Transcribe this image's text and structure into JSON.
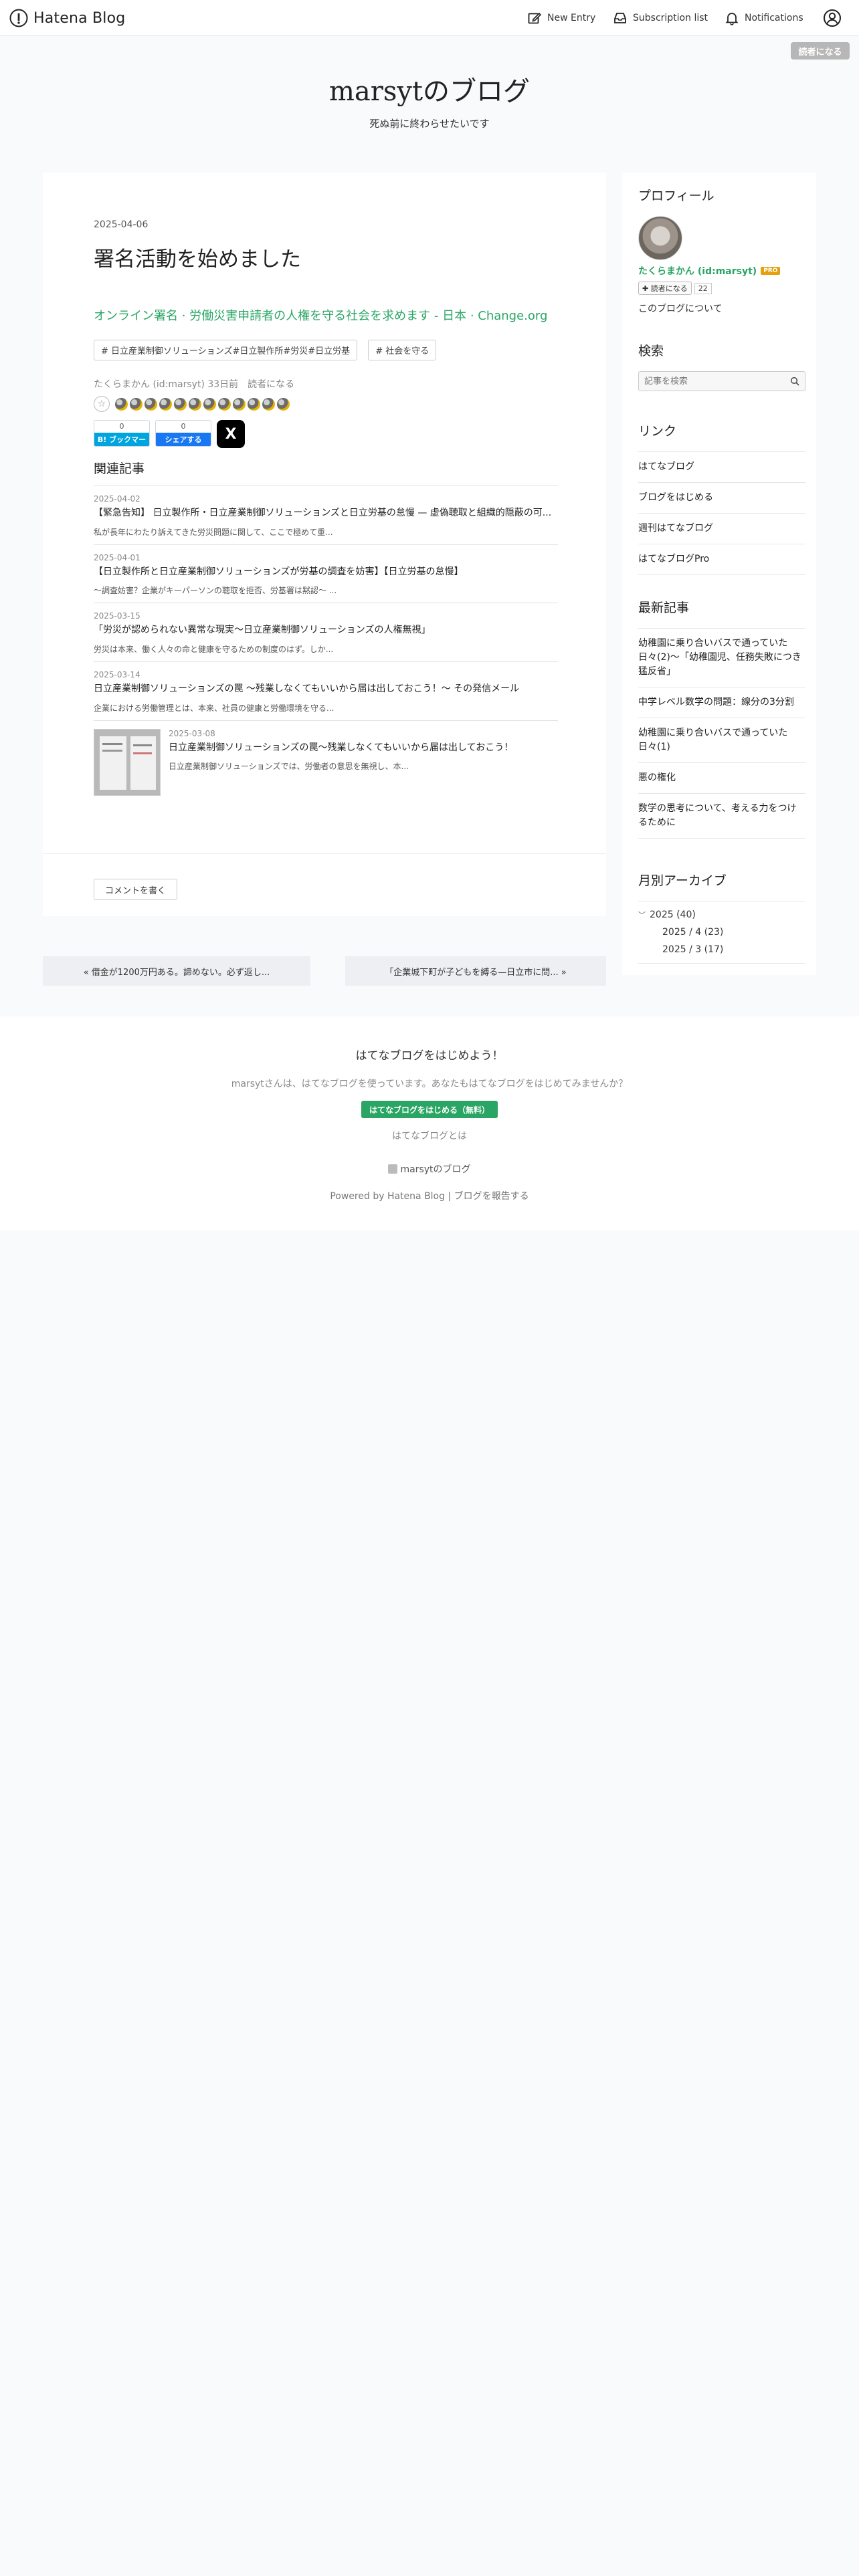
{
  "header": {
    "logo_text": "Hatena Blog",
    "new_entry": "New Entry",
    "subscription_list": "Subscription list",
    "notifications": "Notifications"
  },
  "reader_badge": "読者になる",
  "blog": {
    "title": "marsytのブログ",
    "description": "死ぬ前に終わらせたいです"
  },
  "article": {
    "date": "2025-04-06",
    "title": "署名活動を始めました",
    "link_text": "オンライン署名 · 労働災害申請者の人権を守る社会を求めます - 日本 · Change.org",
    "tags": [
      "# 日立産業制御ソリューションズ#日立製作所#労災#日立労基",
      "# 社会を守る"
    ],
    "byline": "たくらまかん (id:marsyt) 33日前　読者になる",
    "star_count": 12,
    "share": {
      "hatena_count": "0",
      "hatena_label": "B! ブックマーク",
      "fb_count": "0",
      "fb_label": "シェアする",
      "x_label": "X"
    },
    "related_heading": "関連記事",
    "related": [
      {
        "date": "2025-04-02",
        "title": "【緊急告知】 日立製作所・日立産業制御ソリューションズと日立労基の怠慢 — 虚偽聴取と組織的隠蔽の可...",
        "excerpt": "私が長年にわたり訴えてきた労災問題に関して、ここで極めて重..."
      },
      {
        "date": "2025-04-01",
        "title": "【日立製作所と日立産業制御ソリューションズが労基の調査を妨害】【日立労基の怠慢】",
        "excerpt": "〜調査妨害？企業がキーパーソンの聴取を拒否、労基署は黙認〜 ..."
      },
      {
        "date": "2025-03-15",
        "title": "「労災が認められない異常な現実〜日立産業制御ソリューションズの人権無視」",
        "excerpt": "労災は本来、働く人々の命と健康を守るための制度のはず。しか..."
      },
      {
        "date": "2025-03-14",
        "title": "日立産業制御ソリューションズの罠 〜残業しなくてもいいから届は出しておこう！〜 その発信メール",
        "excerpt": "企業における労働管理とは、本来、社員の健康と労働環境を守る..."
      },
      {
        "date": "2025-03-08",
        "title": "日立産業制御ソリューションズの罠〜残業しなくてもいいから届は出しておこう！",
        "excerpt": "日立産業制御ソリューションズでは、労働者の意思を無視し、本..."
      }
    ],
    "comment_button": "コメントを書く"
  },
  "pager": {
    "prev": "« 借金が1200万円ある。諦めない。必ず返し...",
    "next": "「企業城下町が子どもを縛る—日立市に問... »"
  },
  "sidebar": {
    "profile_heading": "プロフィール",
    "profile_name": "たくらまかん (id:marsyt)",
    "pro_badge": "PRO",
    "reader_button": "読者になる",
    "reader_count": "22",
    "about_link": "このブログについて",
    "search_heading": "検索",
    "search_placeholder": "記事を検索",
    "links_heading": "リンク",
    "links": [
      "はてなブログ",
      "ブログをはじめる",
      "週刊はてなブログ",
      "はてなブログPro"
    ],
    "recent_heading": "最新記事",
    "recent": [
      "幼稚園に乗り合いバスで通っていた日々(2)〜「幼稚園児、任務失敗につき猛反省」",
      "中学レベル数学の問題：線分の3分割",
      "幼稚園に乗り合いバスで通っていた日々(1)",
      "悪の権化",
      "数学の思考について、考える力をつけるために"
    ],
    "archive_heading": "月別アーカイブ",
    "archive_year": "2025 (40)",
    "archive_months": [
      "2025 / 4 (23)",
      "2025 / 3 (17)"
    ]
  },
  "footer": {
    "heading": "はてなブログをはじめよう！",
    "sub": "marsytさんは、はてなブログを使っています。あなたもはてなブログをはじめてみませんか？",
    "start_button": "はてなブログをはじめる（無料）",
    "about": "はてなブログとは",
    "blog_name": "marsytのブログ",
    "powered": "Powered by Hatena Blog | ブログを報告する"
  },
  "colors": {
    "accent_green": "#2aa564",
    "hatena_blue": "#00a4de",
    "facebook_blue": "#1877f2",
    "pro_gold": "#e5a00d"
  }
}
